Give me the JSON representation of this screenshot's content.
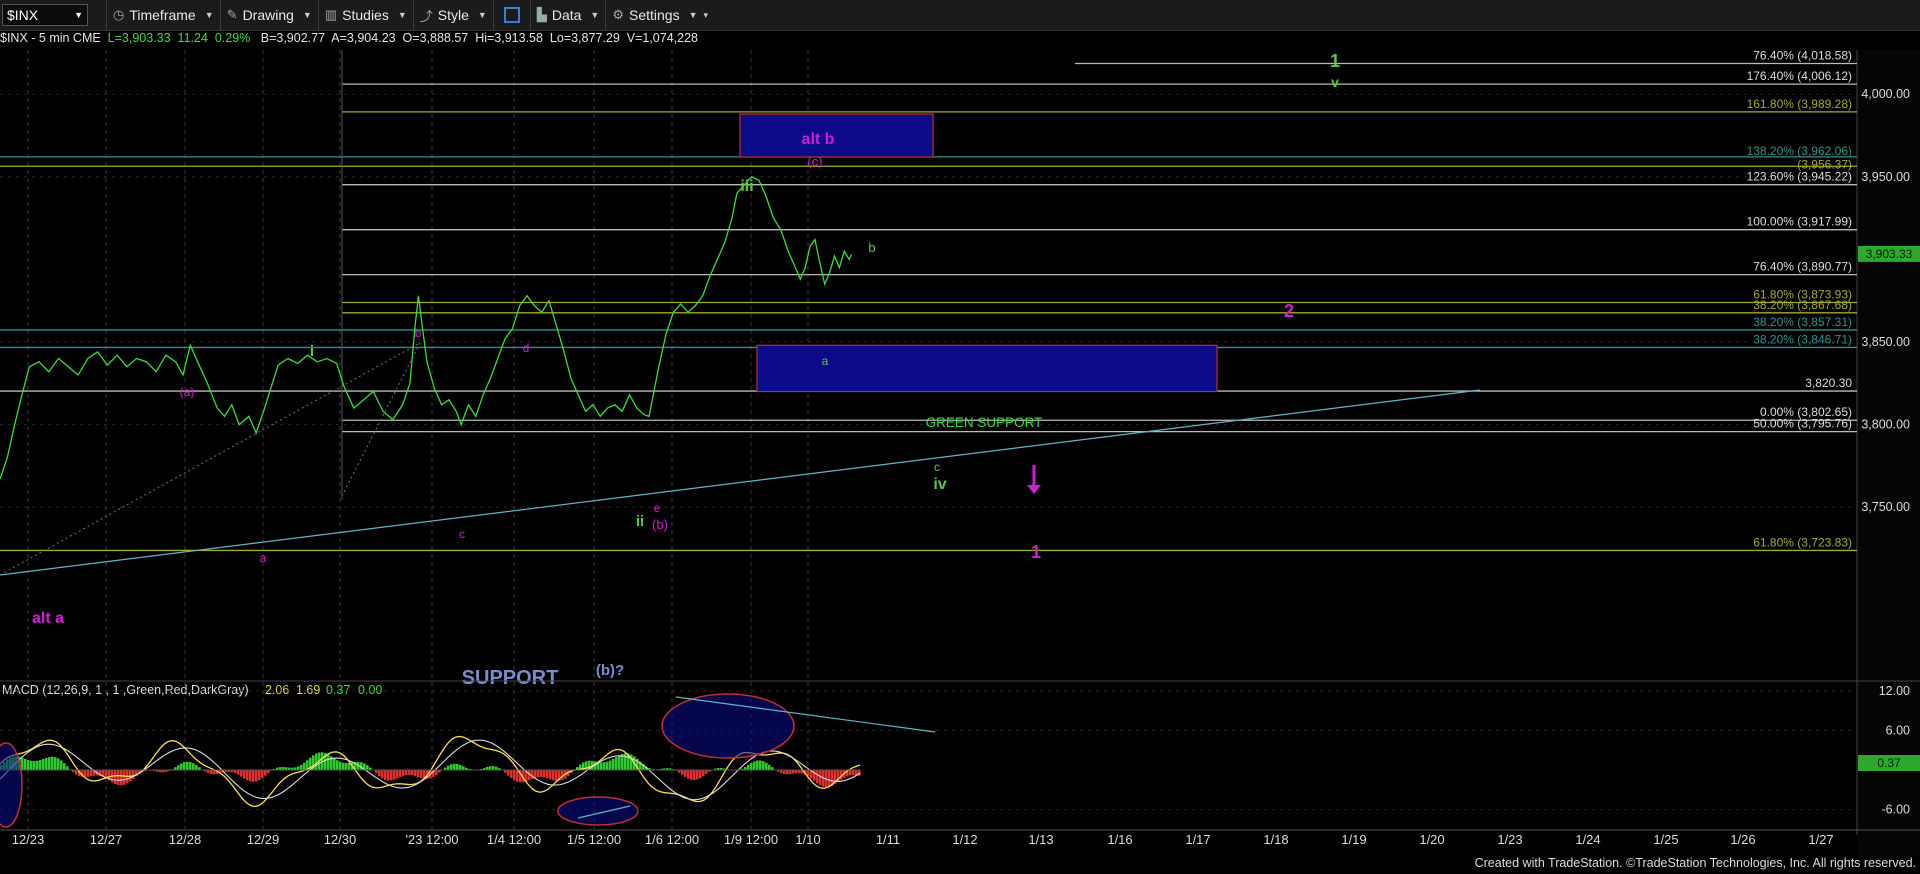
{
  "toolbar": {
    "symbol": "$INX",
    "timeframe": "Timeframe",
    "drawing": "Drawing",
    "studies": "Studies",
    "style": "Style",
    "data": "Data",
    "settings": "Settings"
  },
  "quote": {
    "symbol_line": "$INX - 5 min  CME",
    "last": "L=3,903.33",
    "change": "11.24",
    "pct": "0.29%",
    "bid": "B=3,902.77",
    "ask": "A=3,904.23",
    "open": "O=3,888.57",
    "high": "Hi=3,913.58",
    "low": "Lo=3,877.29",
    "volume": "V=1,074,228"
  },
  "footer": "Created with TradeStation. ©TradeStation Technologies, Inc. All rights reserved.",
  "chart_data": [
    {
      "type": "line",
      "name": "$INX - 5 min",
      "ylim": [
        3700,
        4030
      ],
      "y_ticks": [
        "4,000.00",
        "3,950.00",
        "3,850.00",
        "3,800.00",
        "3,750.00"
      ],
      "last_price_label": "3,903.33",
      "x_ticks": [
        "12/23",
        "12/27",
        "12/28",
        "12/29",
        "12/30",
        "'23 12:00",
        "1/4 12:00",
        "1/5 12:00",
        "1/6 12:00",
        "1/9 12:00",
        "1/10",
        "1/11",
        "1/12",
        "1/13",
        "1/16",
        "1/17",
        "1/18",
        "1/19",
        "1/20",
        "1/23",
        "1/24",
        "1/25",
        "1/26",
        "1/27"
      ],
      "series": [
        {
          "values": [
            [
              0,
              3767
            ],
            [
              6,
              3780
            ],
            [
              12,
              3800
            ],
            [
              18,
              3818
            ],
            [
              24,
              3835
            ],
            [
              32,
              3838
            ],
            [
              40,
              3832
            ],
            [
              48,
              3840
            ],
            [
              56,
              3835
            ],
            [
              64,
              3830
            ],
            [
              72,
              3840
            ],
            [
              80,
              3844
            ],
            [
              88,
              3836
            ],
            [
              96,
              3842
            ],
            [
              104,
              3835
            ],
            [
              112,
              3840
            ],
            [
              120,
              3838
            ],
            [
              128,
              3832
            ],
            [
              136,
              3842
            ],
            [
              144,
              3838
            ],
            [
              150,
              3830
            ],
            [
              156,
              3848
            ],
            [
              162,
              3838
            ],
            [
              170,
              3825
            ],
            [
              178,
              3810
            ],
            [
              184,
              3805
            ],
            [
              190,
              3812
            ],
            [
              196,
              3800
            ],
            [
              204,
              3805
            ],
            [
              210,
              3795
            ],
            [
              216,
              3808
            ],
            [
              222,
              3822
            ],
            [
              228,
              3836
            ],
            [
              236,
              3840
            ],
            [
              244,
              3837
            ],
            [
              252,
              3842
            ],
            [
              260,
              3838
            ],
            [
              268,
              3840
            ],
            [
              276,
              3837
            ],
            [
              282,
              3823
            ],
            [
              290,
              3810
            ],
            [
              298,
              3815
            ],
            [
              306,
              3820
            ],
            [
              314,
              3808
            ],
            [
              322,
              3803
            ],
            [
              330,
              3812
            ],
            [
              336,
              3825
            ],
            [
              340,
              3858
            ],
            [
              343,
              3878
            ],
            [
              346,
              3860
            ],
            [
              350,
              3838
            ],
            [
              356,
              3822
            ],
            [
              362,
              3812
            ],
            [
              368,
              3815
            ],
            [
              374,
              3808
            ],
            [
              378,
              3800
            ],
            [
              384,
              3812
            ],
            [
              390,
              3805
            ],
            [
              396,
              3818
            ],
            [
              402,
              3828
            ],
            [
              408,
              3840
            ],
            [
              414,
              3852
            ],
            [
              420,
              3858
            ],
            [
              426,
              3872
            ],
            [
              432,
              3878
            ],
            [
              438,
              3872
            ],
            [
              444,
              3868
            ],
            [
              450,
              3875
            ],
            [
              456,
              3860
            ],
            [
              462,
              3845
            ],
            [
              468,
              3828
            ],
            [
              474,
              3818
            ],
            [
              480,
              3808
            ],
            [
              486,
              3812
            ],
            [
              492,
              3805
            ],
            [
              498,
              3810
            ],
            [
              504,
              3812
            ],
            [
              510,
              3808
            ],
            [
              516,
              3818
            ],
            [
              522,
              3810
            ],
            [
              528,
              3806
            ],
            [
              532,
              3805
            ],
            [
              536,
              3820
            ],
            [
              540,
              3835
            ],
            [
              546,
              3855
            ],
            [
              552,
              3868
            ],
            [
              558,
              3873
            ],
            [
              564,
              3868
            ],
            [
              570,
              3872
            ],
            [
              576,
              3878
            ],
            [
              582,
              3890
            ],
            [
              588,
              3900
            ],
            [
              594,
              3910
            ],
            [
              600,
              3925
            ],
            [
              604,
              3940
            ],
            [
              610,
              3945
            ],
            [
              616,
              3950
            ],
            [
              622,
              3948
            ],
            [
              628,
              3938
            ],
            [
              634,
              3925
            ],
            [
              640,
              3918
            ],
            [
              646,
              3905
            ],
            [
              652,
              3895
            ],
            [
              656,
              3888
            ],
            [
              660,
              3895
            ],
            [
              664,
              3908
            ],
            [
              668,
              3912
            ],
            [
              672,
              3898
            ],
            [
              676,
              3885
            ],
            [
              680,
              3892
            ],
            [
              684,
              3902
            ],
            [
              688,
              3895
            ],
            [
              692,
              3905
            ],
            [
              696,
              3900
            ],
            [
              698,
              3903
            ]
          ]
        }
      ],
      "levels": [
        {
          "label": "76.40% (4,018.58)",
          "value": 4018.58,
          "color": "#bbbbbb"
        },
        {
          "label": "176.40% (4,006.12)",
          "value": 4006.12,
          "color": "#bbbbbb"
        },
        {
          "label": "161.80% (3,989.28)",
          "value": 3989.28,
          "color": "#a8a830"
        },
        {
          "label": "138.20% (3,962.06)",
          "value": 3962.06,
          "color": "#2f8f8f"
        },
        {
          "label": "(3,956.37)",
          "value": 3956.37,
          "color": "#a8a830"
        },
        {
          "label": "123.60% (3,945.22)",
          "value": 3945.22,
          "color": "#bbbbbb"
        },
        {
          "label": "100.00% (3,917.99)",
          "value": 3917.99,
          "color": "#bbbbbb"
        },
        {
          "label": "76.40% (3,890.77)",
          "value": 3890.77,
          "color": "#bbbbbb"
        },
        {
          "label": "61.80% (3,873.93)",
          "value": 3873.93,
          "color": "#a8a830"
        },
        {
          "label": "38.20% (3,867.68)",
          "value": 3867.68,
          "color": "#a8a830"
        },
        {
          "label": "38.20% (3,857.31)",
          "value": 3857.31,
          "color": "#2f8f8f"
        },
        {
          "label": "38.20% (3,846.71)",
          "value": 3846.71,
          "color": "#2f8f8f"
        },
        {
          "label": "3,820.30",
          "value": 3820.3,
          "color": "#bbbbbb"
        },
        {
          "label": "0.00% (3,802.65)",
          "value": 3802.65,
          "color": "#bbbbbb"
        },
        {
          "label": "50.00% (3,795.76)",
          "value": 3795.76,
          "color": "#bbbbbb"
        },
        {
          "label": "61.80% (3,723.83)",
          "value": 3723.83,
          "color": "#a8a830"
        }
      ],
      "zones": [
        {
          "label": "alt b",
          "sublabel": "(c)",
          "from_y": 3962,
          "to_y": 3988
        },
        {
          "label": "GREEN SUPPORT",
          "sublabel": "",
          "from_y": 3820,
          "to_y": 3848
        }
      ],
      "annotations": [
        {
          "text": "1",
          "color": "#5cc83c"
        },
        {
          "text": "v",
          "color": "#5cc83c"
        },
        {
          "text": "alt b",
          "color": "#d21ed2"
        },
        {
          "text": "(c)",
          "color": "#d21ed2"
        },
        {
          "text": "iii",
          "color": "#5cc83c"
        },
        {
          "text": "b",
          "color": "#5cc83c"
        },
        {
          "text": "2",
          "color": "#d21ed2"
        },
        {
          "text": "a",
          "color": "#5cc83c"
        },
        {
          "text": "i",
          "color": "#5cc83c"
        },
        {
          "text": "(a)",
          "color": "#d21ed2"
        },
        {
          "text": "b",
          "color": "#d21ed2"
        },
        {
          "text": "d",
          "color": "#d21ed2"
        },
        {
          "text": "c",
          "color": "#5cc83c"
        },
        {
          "text": "iv",
          "color": "#5cc83c"
        },
        {
          "text": "c",
          "color": "#d21ed2"
        },
        {
          "text": "e",
          "color": "#d21ed2"
        },
        {
          "text": "ii",
          "color": "#5cc83c"
        },
        {
          "text": "(b)",
          "color": "#d21ed2"
        },
        {
          "text": "a",
          "color": "#d21ed2"
        },
        {
          "text": "1",
          "color": "#d21ed2"
        },
        {
          "text": "alt a",
          "color": "#d21ed2"
        },
        {
          "text": "SUPPORT",
          "color": "#7b8ccc"
        },
        {
          "text": "(b)?",
          "color": "#7b8ccc"
        }
      ]
    },
    {
      "type": "line",
      "name": "MACD",
      "title": "MACD (12,26,9, 1 , 1 ,Green,Red,DarkGray)",
      "values_label": [
        "2.06",
        "1.69",
        "0.37",
        "0.00"
      ],
      "ylim": [
        -9,
        15
      ],
      "y_ticks": [
        "12.00",
        "6.00",
        "-6.00"
      ],
      "last_value_label": "0.37"
    }
  ]
}
